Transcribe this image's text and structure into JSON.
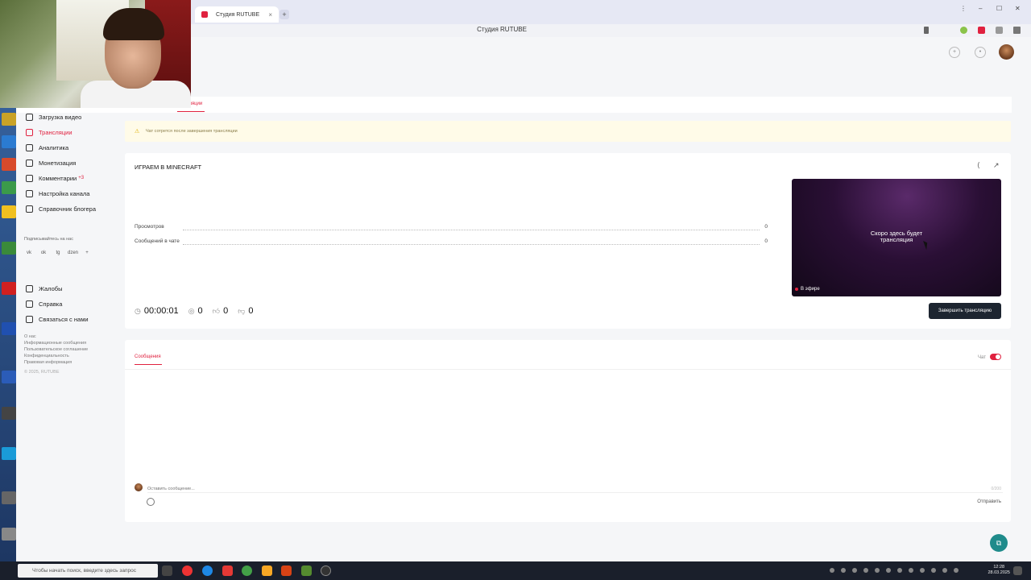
{
  "browser": {
    "tab_title": "Студия RUTUBE",
    "tab_close": "×",
    "new_tab": "+",
    "address_title": "Студия RUTUBE",
    "window_controls": [
      "⋮",
      "–",
      "☐",
      "✕"
    ]
  },
  "subnav": {
    "active_label": "Трансляции"
  },
  "sidebar": {
    "items": [
      {
        "label": "Загрузка видео",
        "icon": "upload-icon",
        "active": false
      },
      {
        "label": "Трансляции",
        "icon": "broadcast-icon",
        "active": true
      },
      {
        "label": "Аналитика",
        "icon": "analytics-icon",
        "active": false
      },
      {
        "label": "Монетизация",
        "icon": "coin-icon",
        "active": false
      },
      {
        "label": "Комментарии",
        "icon": "comment-icon",
        "active": false,
        "badge": "+3"
      },
      {
        "label": "Настройка канала",
        "icon": "settings-icon",
        "active": false
      },
      {
        "label": "Справочник блогера",
        "icon": "book-icon",
        "active": false
      }
    ],
    "subscribe_label": "Подписывайтесь на нас",
    "socials": [
      "vk",
      "ok",
      "tg",
      "dzen",
      "+"
    ],
    "support_items": [
      {
        "label": "Жалобы",
        "icon": "flag-icon"
      },
      {
        "label": "Справка",
        "icon": "help-icon"
      },
      {
        "label": "Связаться с нами",
        "icon": "mail-icon"
      }
    ],
    "footer_links": [
      "О нас",
      "Информационные сообщения",
      "Пользовательское соглашение",
      "Конфиденциальность",
      "Правовая информация"
    ],
    "copyright": "© 2025, RUTUBE"
  },
  "notice": {
    "text": "Чат сотрется после завершения трансляции"
  },
  "stream": {
    "title": "ИГРАЕМ В MINECRAFT",
    "stats": [
      {
        "label": "Просмотров",
        "value": "0"
      },
      {
        "label": "Сообщений в чате",
        "value": "0"
      }
    ],
    "duration": "00:00:01",
    "viewers": "0",
    "likes": "0",
    "dislikes": "0",
    "player_text_line1": "Скоро здесь будет",
    "player_text_line2": "трансляция",
    "live_label": "В эфире",
    "end_button": "Завершить трансляцию"
  },
  "chat": {
    "tab_label": "Сообщения",
    "toggle_label": "Чат",
    "input_placeholder": "Оставить сообщение...",
    "char_count": "0/200",
    "send_label": "Отправить"
  },
  "taskbar": {
    "search_placeholder": "Чтобы начать поиск, введите здесь запрос",
    "time": "12:28",
    "date": "28.03.2025"
  },
  "colors": {
    "accent": "#e0213f",
    "dark_button": "#1d2530",
    "notice_bg": "#fffbe8"
  }
}
